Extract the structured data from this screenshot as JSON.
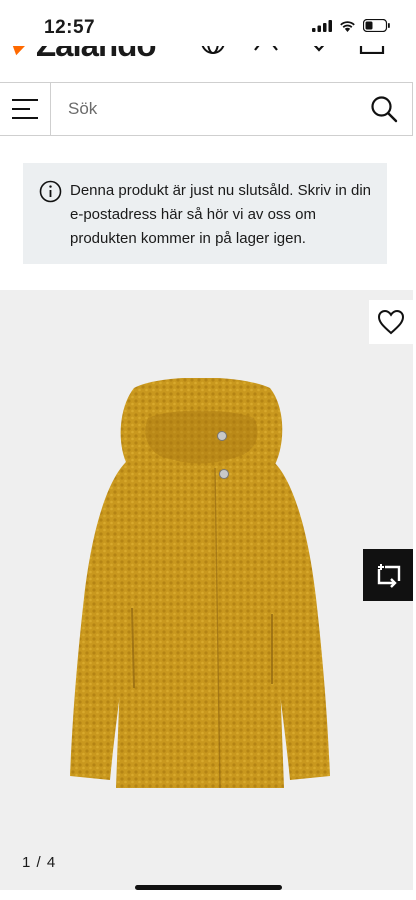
{
  "status_bar": {
    "time": "12:57"
  },
  "brand": {
    "name": "Zalando",
    "accent_color": "#ff6900"
  },
  "search": {
    "placeholder": "Sök"
  },
  "notice": {
    "text": "Denna produkt är just nu slutsåld. Skriv in din e-postadress här så hör vi av oss om produkten kommer in på lager igen."
  },
  "gallery": {
    "counter": "1 / 4",
    "current_image": 1,
    "total_images": 4
  },
  "product": {
    "color": "#c9981e"
  },
  "icons": [
    "signal-icon",
    "wifi-icon",
    "battery-icon",
    "globe-icon",
    "close-icon",
    "heart-icon",
    "bag-icon",
    "menu-icon",
    "search-icon",
    "info-icon",
    "wishlist-heart-icon",
    "compare-icon"
  ]
}
